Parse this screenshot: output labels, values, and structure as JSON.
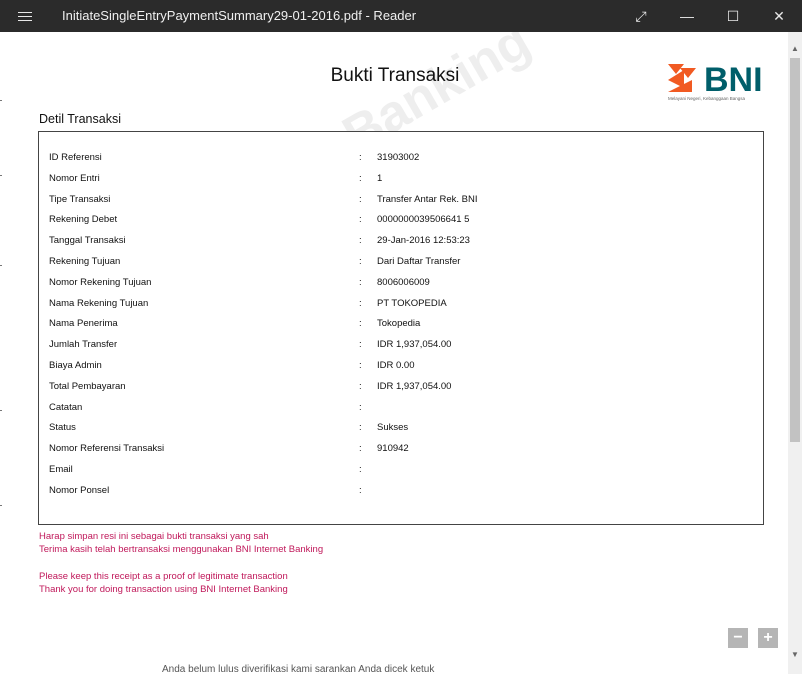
{
  "window": {
    "title": "InitiateSingleEntryPaymentSummary29-01-2016.pdf - Reader",
    "expand_glyph": "⤢",
    "minimize_glyph": "—",
    "maximize_glyph": "☐",
    "close_glyph": "✕"
  },
  "document": {
    "title": "Bukti Transaksi",
    "logo_text": "BNI",
    "logo_tagline": "Melayani Negeri, Kebanggaan Bangsa",
    "section_label": "Detil Transaksi",
    "watermark": "BNI Internet Banking",
    "separator": ":",
    "rows": [
      {
        "label": "ID Referensi",
        "value": "31903002"
      },
      {
        "label": "Nomor Entri",
        "value": "1"
      },
      {
        "label": "Tipe Transaksi",
        "value": "Transfer Antar Rek. BNI"
      },
      {
        "label": "Rekening Debet",
        "value": "0000000039506641 5"
      },
      {
        "label": "Tanggal Transaksi",
        "value": "29-Jan-2016 12:53:23"
      },
      {
        "label": "Rekening Tujuan",
        "value": "Dari Daftar Transfer"
      },
      {
        "label": "Nomor Rekening Tujuan",
        "value": "8006006009"
      },
      {
        "label": "Nama Rekening Tujuan",
        "value": "PT TOKOPEDIA"
      },
      {
        "label": "Nama Penerima",
        "value": "Tokopedia"
      },
      {
        "label": "Jumlah Transfer",
        "value": "IDR 1,937,054.00"
      },
      {
        "label": "Biaya Admin",
        "value": "IDR 0.00"
      },
      {
        "label": "Total Pembayaran",
        "value": "IDR 1,937,054.00"
      },
      {
        "label": "Catatan",
        "value": ""
      },
      {
        "label": "Status",
        "value": "Sukses"
      },
      {
        "label": "Nomor Referensi Transaksi",
        "value": "910942"
      },
      {
        "label": "Email",
        "value": ""
      },
      {
        "label": "Nomor Ponsel",
        "value": ""
      }
    ],
    "notes": [
      "Harap simpan resi ini sebagai bukti transaksi yang sah",
      "Terima kasih telah bertransaksi menggunakan BNI Internet Banking",
      "Please keep this receipt as a proof of legitimate transaction",
      "Thank you for doing transaction using BNI Internet Banking"
    ]
  },
  "zoom": {
    "minus": "−",
    "plus": "+"
  },
  "background_text": "Anda belum lulus diverifikasi kami sarankan Anda dicek ketuk"
}
